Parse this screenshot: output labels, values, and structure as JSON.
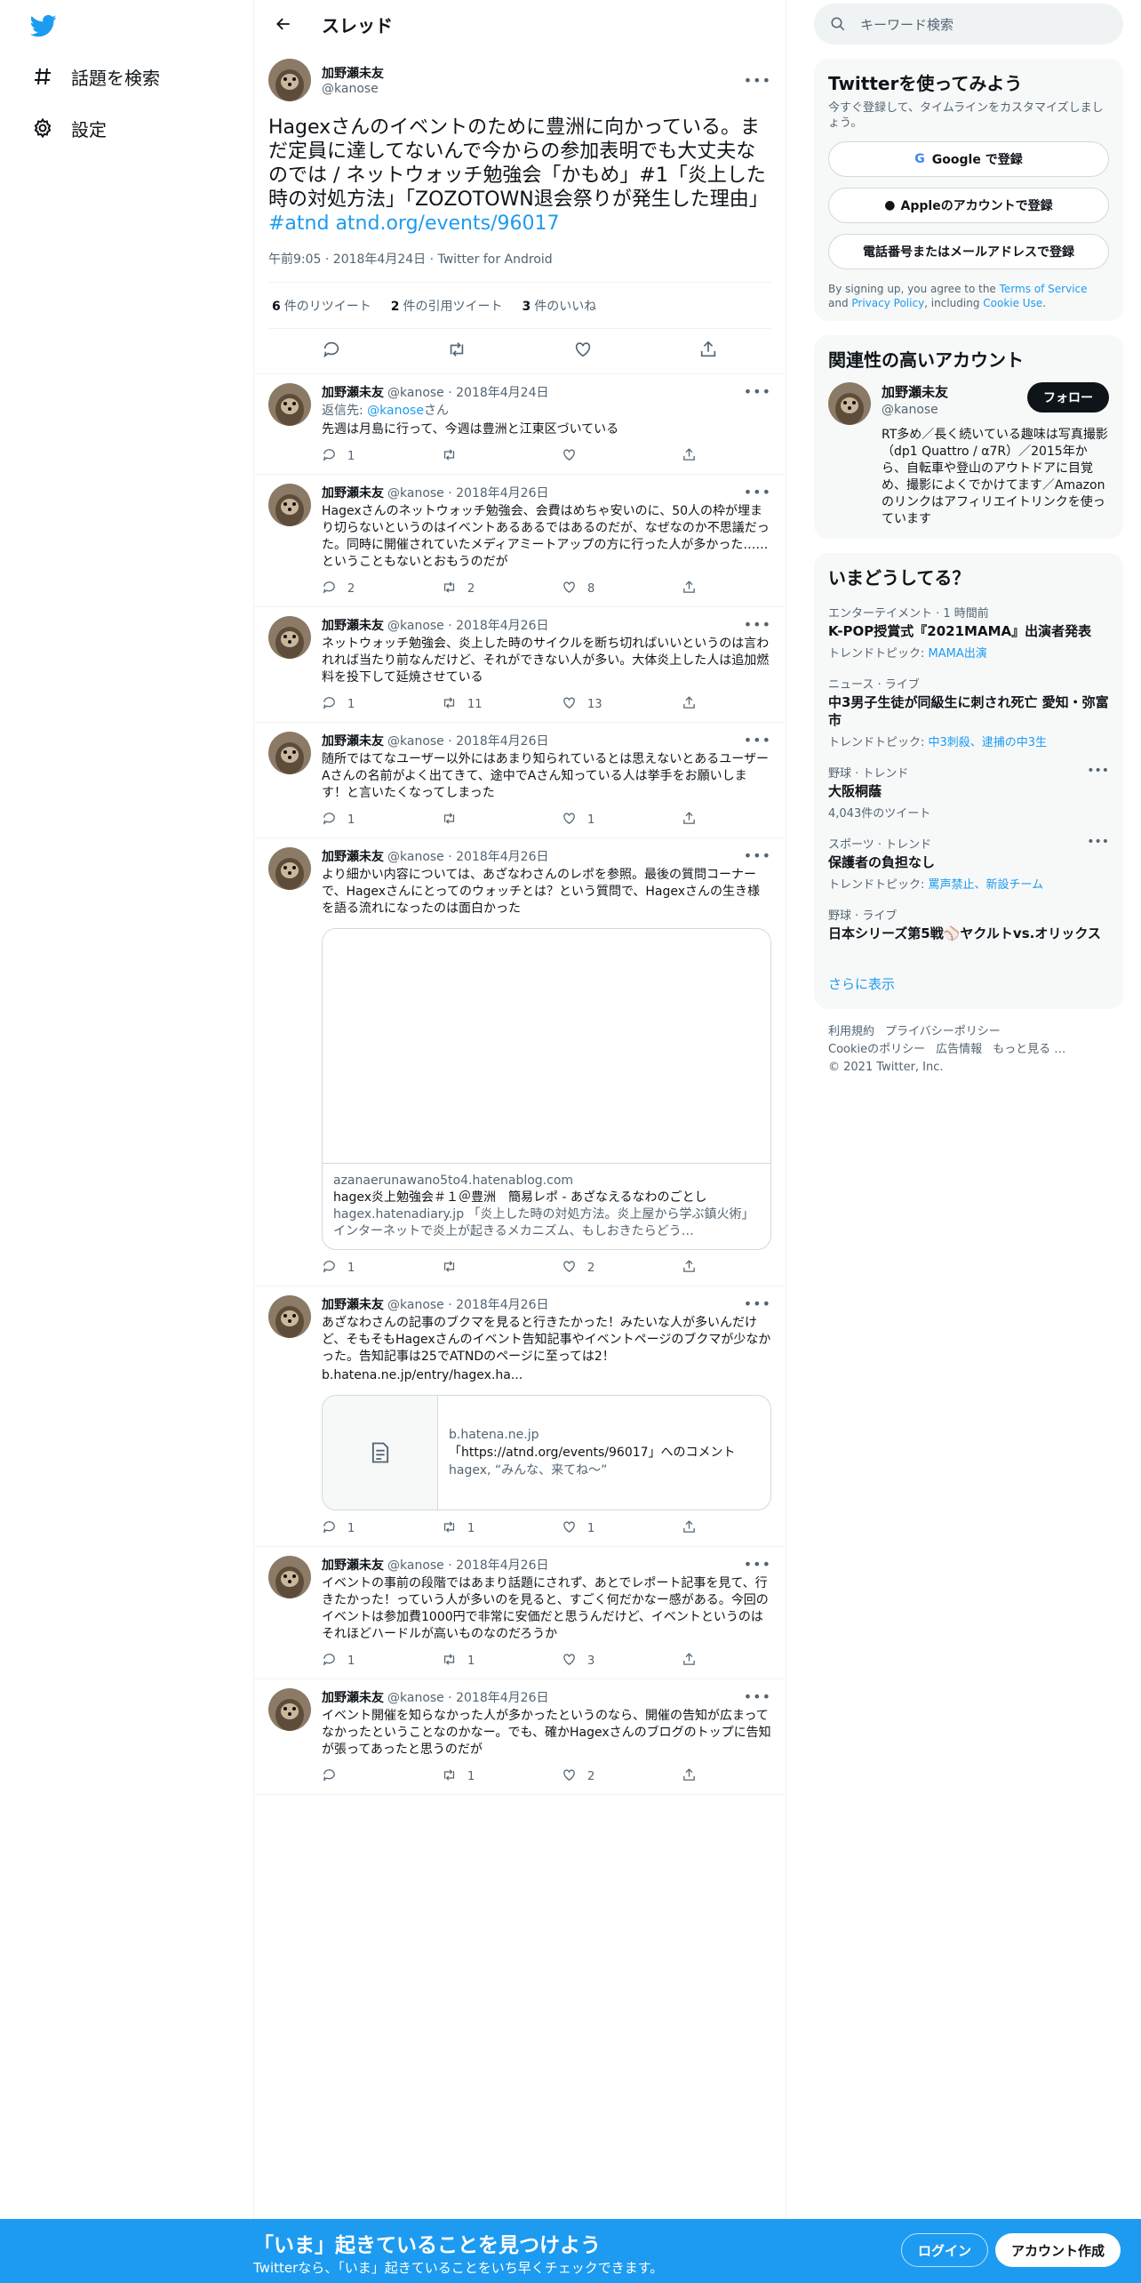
{
  "nav": {
    "explore": "話題を検索",
    "settings": "設定"
  },
  "header": {
    "title": "スレッド"
  },
  "main": {
    "name": "加野瀬未友",
    "handle": "@kanose",
    "text": "Hagexさんのイベントのために豊洲に向かっている。まだ定員に達してないんで今からの参加表明でも大丈夫なのでは / ネットウォッチ勉強会「かもめ」#1「炎上した時の対処方法」「ZOZOTOWN退会祭りが発生した理由」",
    "hashtag": "#atnd",
    "link": "atnd.org/events/96017",
    "time": "午前9:05 · 2018年4月24日 · Twitter for Android",
    "rt_count": "6",
    "rt_label": "件のリツイート",
    "qt_count": "2",
    "qt_label": "件の引用ツイート",
    "like_count": "3",
    "like_label": "件のいいね"
  },
  "replies": [
    {
      "name": "加野瀬未友",
      "meta": "@kanose · 2018年4月24日",
      "reply_prefix": "返信先: ",
      "reply_to": "@kanose",
      "reply_suffix": "さん",
      "text": "先週は月島に行って、今週は豊洲と江東区づいている",
      "c": "1",
      "r": "",
      "l": ""
    },
    {
      "name": "加野瀬未友",
      "meta": "@kanose · 2018年4月26日",
      "text": "Hagexさんのネットウォッチ勉強会、会費はめちゃ安いのに、50人の枠が埋まり切らないというのはイベントあるあるではあるのだが、なぜなのか不思議だった。同時に開催されていたメディアミートアップの方に行った人が多かった……ということもないとおもうのだが",
      "c": "2",
      "r": "2",
      "l": "8"
    },
    {
      "name": "加野瀬未友",
      "meta": "@kanose · 2018年4月26日",
      "text": "ネットウォッチ勉強会、炎上した時のサイクルを断ち切ればいいというのは言われれば当たり前なんだけど、それができない人が多い。大体炎上した人は追加燃料を投下して延焼させている",
      "c": "1",
      "r": "11",
      "l": "13"
    },
    {
      "name": "加野瀬未友",
      "meta": "@kanose · 2018年4月26日",
      "text": "随所ではてなユーザー以外にはあまり知られているとは思えないとあるユーザーAさんの名前がよく出てきて、途中でAさん知っている人は挙手をお願いします！と言いたくなってしまった",
      "c": "1",
      "r": "",
      "l": "1"
    },
    {
      "name": "加野瀬未友",
      "meta": "@kanose · 2018年4月26日",
      "text": "より細かい内容については、あざなわさんのレポを参照。最後の質問コーナーで、Hagexさんにとってのウォッチとは？という質問で、Hagexさんの生き様を語る流れになったのは面白かった",
      "c": "1",
      "r": "",
      "l": "2",
      "card": {
        "domain": "azanaerunawano5to4.hatenablog.com",
        "title": "hagex炎上勉強会＃１＠豊洲　簡易レポ - あざなえるなわのごとし",
        "desc": "hagex.hatenadiary.jp 「炎上した時の対処方法。炎上屋から学ぶ鎮火術」 インターネットで炎上が起きるメカニズム、もしおきたらどう…"
      }
    },
    {
      "name": "加野瀬未友",
      "meta": "@kanose · 2018年4月26日",
      "text": "あざなわさんの記事のブクマを見ると行きたかった！みたいな人が多いんだけど、そもそもHagexさんのイベント告知記事やイベントページのブクマが少なかった。告知記事は25でATNDのページに至っては2！",
      "link": "b.hatena.ne.jp/entry/hagex.ha...",
      "c": "1",
      "r": "1",
      "l": "1",
      "card2": {
        "domain": "b.hatena.ne.jp",
        "title": "「https://atnd.org/events/96017」へのコメント",
        "desc": "hagex, “みんな、来てね〜”"
      }
    },
    {
      "name": "加野瀬未友",
      "meta": "@kanose · 2018年4月26日",
      "text": "イベントの事前の段階ではあまり話題にされず、あとでレポート記事を見て、行きたかった！っていう人が多いのを見ると、すごく何だかなー感がある。今回のイベントは参加費1000円で非常に安価だと思うんだけど、イベントというのはそれほどハードルが高いものなのだろうか",
      "c": "1",
      "r": "1",
      "l": "3"
    },
    {
      "name": "加野瀬未友",
      "meta": "@kanose · 2018年4月26日",
      "text": "イベント開催を知らなかった人が多かったというのなら、開催の告知が広まってなかったということなのかなー。でも、確かHagexさんのブログのトップに告知が張ってあったと思うのだが",
      "c": "",
      "r": "1",
      "l": "2"
    }
  ],
  "sidebar": {
    "search_placeholder": "キーワード検索",
    "signup": {
      "title": "Twitterを使ってみよう",
      "sub": "今すぐ登録して、タイムラインをカスタマイズしましょう。",
      "google": "Google で登録",
      "apple": "Appleのアカウントで登録",
      "phone": "電話番号またはメールアドレスで登録",
      "fine_1": "By signing up, you agree to the ",
      "tos": "Terms of Service",
      "fine_2": " and ",
      "privacy": "Privacy Policy",
      "fine_3": ", including ",
      "cookie": "Cookie Use",
      "fine_4": "."
    },
    "related": {
      "title": "関連性の高いアカウント",
      "name": "加野瀬未友",
      "handle": "@kanose",
      "follow": "フォロー",
      "bio": "RT多め／長く続いている趣味は写真撮影（dp1 Quattro / α7R）／2015年から、自転車や登山のアウトドアに目覚め、撮影によくでかけてます／Amazonのリンクはアフィリエイトリンクを使っています"
    },
    "trends": {
      "title": "いまどうしてる？",
      "items": [
        {
          "meta": "エンターテイメント · 1 時間前",
          "title": "K-POP授賞式『2021MAMA』出演者発表",
          "topic_label": "トレンドトピック: ",
          "topic": "MAMA出演"
        },
        {
          "meta": "ニュース · ライブ",
          "title": "中3男子生徒が同級生に刺され死亡 愛知・弥富市",
          "topic_label": "トレンドトピック: ",
          "topic": "中3刺殺、逮捕の中3生"
        },
        {
          "meta": "野球 · トレンド",
          "title": "大阪桐蔭",
          "sub": "4,043件のツイート"
        },
        {
          "meta": "スポーツ · トレンド",
          "title": "保護者の負担なし",
          "topic_label": "トレンドトピック: ",
          "topic": "罵声禁止、新設チーム"
        },
        {
          "meta": "野球 · ライブ",
          "title": "日本シリーズ第5戦⚾ヤクルトvs.オリックス"
        }
      ],
      "more": "さらに表示"
    },
    "footer": {
      "terms": "利用規約",
      "privacy": "プライバシーポリシー",
      "cookie": "Cookieのポリシー",
      "ads": "広告情報",
      "more": "もっと見る …",
      "copy": "© 2021 Twitter, Inc."
    }
  },
  "bottom": {
    "title": "「いま」起きていることを見つけよう",
    "sub": "Twitterなら、「いま」起きていることをいち早くチェックできます。",
    "login": "ログイン",
    "signup": "アカウント作成"
  }
}
